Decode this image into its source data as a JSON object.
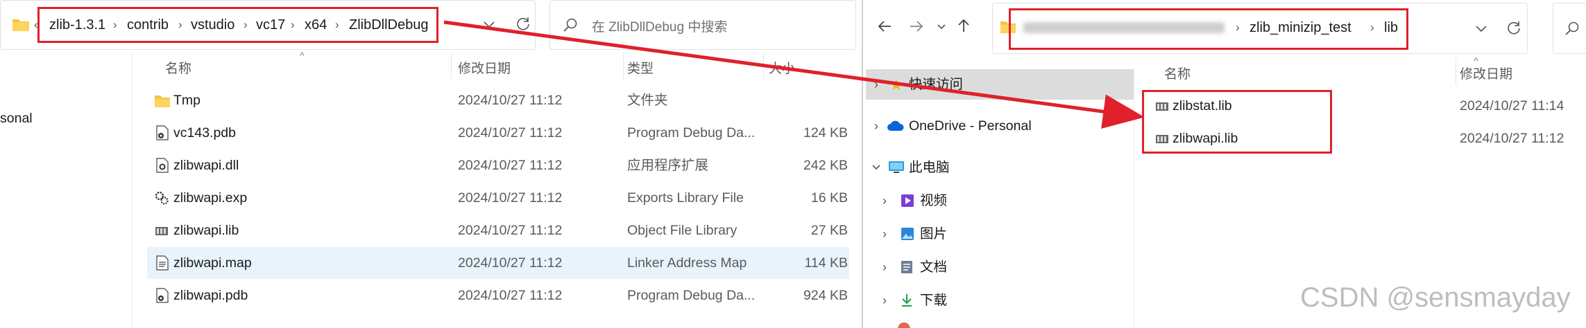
{
  "left": {
    "breadcrumb": [
      "zlib-1.3.1",
      "contrib",
      "vstudio",
      "vc17",
      "x64",
      "ZlibDllDebug"
    ],
    "search_placeholder": "在 ZlibDllDebug 中搜索",
    "sidebar_partial_label": "sonal",
    "columns": {
      "name": "名称",
      "date": "修改日期",
      "type": "类型",
      "size": "大小"
    },
    "files": [
      {
        "name": "Tmp",
        "date": "2024/10/27 11:12",
        "type": "文件夹",
        "size": "",
        "icon": "folder-icon"
      },
      {
        "name": "vc143.pdb",
        "date": "2024/10/27 11:12",
        "type": "Program Debug Da...",
        "size": "124 KB",
        "icon": "pdb-file-icon"
      },
      {
        "name": "zlibwapi.dll",
        "date": "2024/10/27 11:12",
        "type": "应用程序扩展",
        "size": "242 KB",
        "icon": "dll-file-icon"
      },
      {
        "name": "zlibwapi.exp",
        "date": "2024/10/27 11:12",
        "type": "Exports Library File",
        "size": "16 KB",
        "icon": "exp-file-icon"
      },
      {
        "name": "zlibwapi.lib",
        "date": "2024/10/27 11:12",
        "type": "Object File Library",
        "size": "27 KB",
        "icon": "lib-file-icon"
      },
      {
        "name": "zlibwapi.map",
        "date": "2024/10/27 11:12",
        "type": "Linker Address Map",
        "size": "114 KB",
        "icon": "map-file-icon",
        "selected": true
      },
      {
        "name": "zlibwapi.pdb",
        "date": "2024/10/27 11:12",
        "type": "Program Debug Da...",
        "size": "924 KB",
        "icon": "pdb-file-icon"
      }
    ]
  },
  "right": {
    "breadcrumb": [
      "zlib_minizip_test",
      "lib"
    ],
    "columns": {
      "name": "名称",
      "date": "修改日期"
    },
    "nav": [
      {
        "label": "快速访问",
        "icon": "star-icon"
      },
      {
        "label": "OneDrive - Personal",
        "icon": "cloud-icon"
      },
      {
        "label": "此电脑",
        "icon": "monitor-icon"
      },
      {
        "label": "视频",
        "icon": "video-icon"
      },
      {
        "label": "图片",
        "icon": "picture-icon"
      },
      {
        "label": "文档",
        "icon": "document-icon"
      },
      {
        "label": "下载",
        "icon": "download-icon"
      }
    ],
    "files": [
      {
        "name": "zlibstat.lib",
        "date": "2024/10/27 11:14",
        "icon": "lib-file-icon"
      },
      {
        "name": "zlibwapi.lib",
        "date": "2024/10/27 11:12",
        "icon": "lib-file-icon"
      }
    ]
  },
  "watermark": "CSDN @sensmayday",
  "annotation_color": "#e0202a"
}
